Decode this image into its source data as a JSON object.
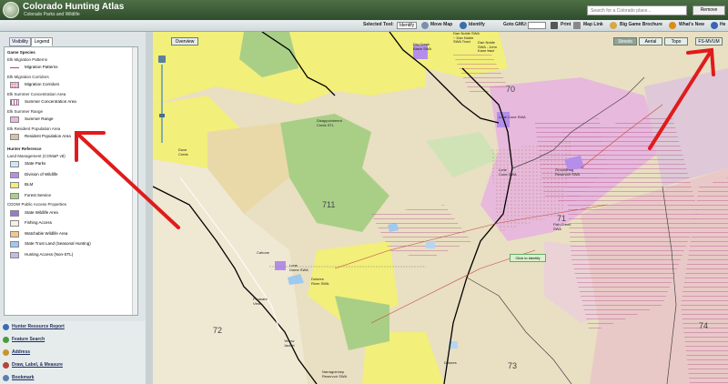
{
  "header": {
    "title": "Colorado Hunting Atlas",
    "subtitle": "Colorado Parks and Wildlife",
    "search_placeholder": "Search for a Colorado place...",
    "remove_label": "Remove"
  },
  "toolbar": {
    "selected_tool_label": "Selected Tool:",
    "selected_tool_value": "Identify",
    "move_map": "Move Map",
    "identify": "Identify",
    "goto_gmu_label": "Goto GMU:",
    "print": "Print",
    "map_link": "Map Link",
    "big_game_brochure": "Big Game Brochure",
    "whats_new": "What's New",
    "help": "He"
  },
  "panel": {
    "tab_visibility": "Visibility",
    "tab_legend": "Legend",
    "legend": [
      {
        "text": "Game Species",
        "kind": "h"
      },
      {
        "text": "Elk Migration Patterns",
        "kind": "h2"
      },
      {
        "text": "Migration Patterns",
        "kind": "item",
        "swatch": "line"
      },
      {
        "text": "Elk Migration Corridors",
        "kind": "h2"
      },
      {
        "text": "Migration Corridors",
        "kind": "item",
        "swatch": "dots"
      },
      {
        "text": "Elk Summer Concentration Area",
        "kind": "h2"
      },
      {
        "text": "Summer Concentration Area",
        "kind": "item",
        "swatch": "hatch"
      },
      {
        "text": "Elk Summer Range",
        "kind": "h2"
      },
      {
        "text": "Summer Range",
        "kind": "item",
        "swatch": "pink"
      },
      {
        "text": "Elk Resident Population Area",
        "kind": "h2"
      },
      {
        "text": "Resident Population Area",
        "kind": "item",
        "swatch": "tan"
      },
      {
        "text": "Hunter Reference",
        "kind": "h"
      },
      {
        "text": "Land Management (COMaP v8)",
        "kind": "h2"
      },
      {
        "text": "State Parks",
        "kind": "item",
        "swatch": "lightblue"
      },
      {
        "text": "Division of Wildlife",
        "kind": "item",
        "swatch": "purple"
      },
      {
        "text": "BLM",
        "kind": "item",
        "swatch": "yellow"
      },
      {
        "text": "Forest Service",
        "kind": "item",
        "swatch": "green"
      },
      {
        "text": "CDOW Public Access Properties",
        "kind": "h2"
      },
      {
        "text": "State Wildlife Area",
        "kind": "item",
        "swatch": "violet"
      },
      {
        "text": "Fishing Access",
        "kind": "item",
        "swatch": "pale"
      },
      {
        "text": "Watchable Wildlife Area",
        "kind": "item",
        "swatch": "peach"
      },
      {
        "text": "State Trust Land (Seasonal Hunting)",
        "kind": "item",
        "swatch": "skyblue"
      },
      {
        "text": "Hunting Access (Non-STL)",
        "kind": "item",
        "swatch": "lavender"
      }
    ]
  },
  "bottom_nav": [
    {
      "label": "Hunter Resource Report",
      "color": "#3a6db5"
    },
    {
      "label": "Feature Search",
      "color": "#4b9c3a"
    },
    {
      "label": "Address",
      "color": "#c8962c"
    },
    {
      "label": "Draw, Label, & Measure",
      "color": "#b0473a"
    },
    {
      "label": "Bookmark",
      "color": "#5a7fb0"
    }
  ],
  "map": {
    "overview_label": "Overview",
    "streets_label": "Streets",
    "aerial_label": "Aerial",
    "topo_label": "Topo",
    "fs_mvum_label": "FS-MVUM",
    "click_identify": "Click to identify",
    "units": [
      "70",
      "711",
      "71",
      "72",
      "73",
      "74"
    ],
    "labels": {
      "dry_creek": "Dry Creek\nBasin SWA",
      "dan_noble": "Dan Noble SWA\n~ Dan Noble\nSWA Tract",
      "dan_noble_sa": "Dan Noble\nSWA - John\nKane tract",
      "disappointment": "Disappointment\nCreek STL",
      "lone_cone": "Lone Cone SWA",
      "dove_creek": "Dove\nCreek",
      "cahone": "Cahone",
      "dolores": "Dolores",
      "lone_dome": "Lone\nDome SWA",
      "dolores_swa": "Dolores\nRiver SWA",
      "pleasant_view": "Pleasant\nView",
      "yellow_jacket": "Yellow\nJacket",
      "narraguinnep": "Narraguinnep\nReservoir SWA",
      "groundhog": "Groundhog\nReservoir SWA",
      "fish_creek": "Fish Creek\nSWA",
      "lone_cone2": "Lone\nCone SWA"
    }
  },
  "colors": {
    "header": "#3d5e38",
    "annotation_arrow": "#e01b1b",
    "forest": "#a9cf87",
    "blm": "#f2ef7a",
    "swa": "#b48ee8",
    "summer_range": "#e7b9dc",
    "gmu_boundary": "#000000"
  }
}
